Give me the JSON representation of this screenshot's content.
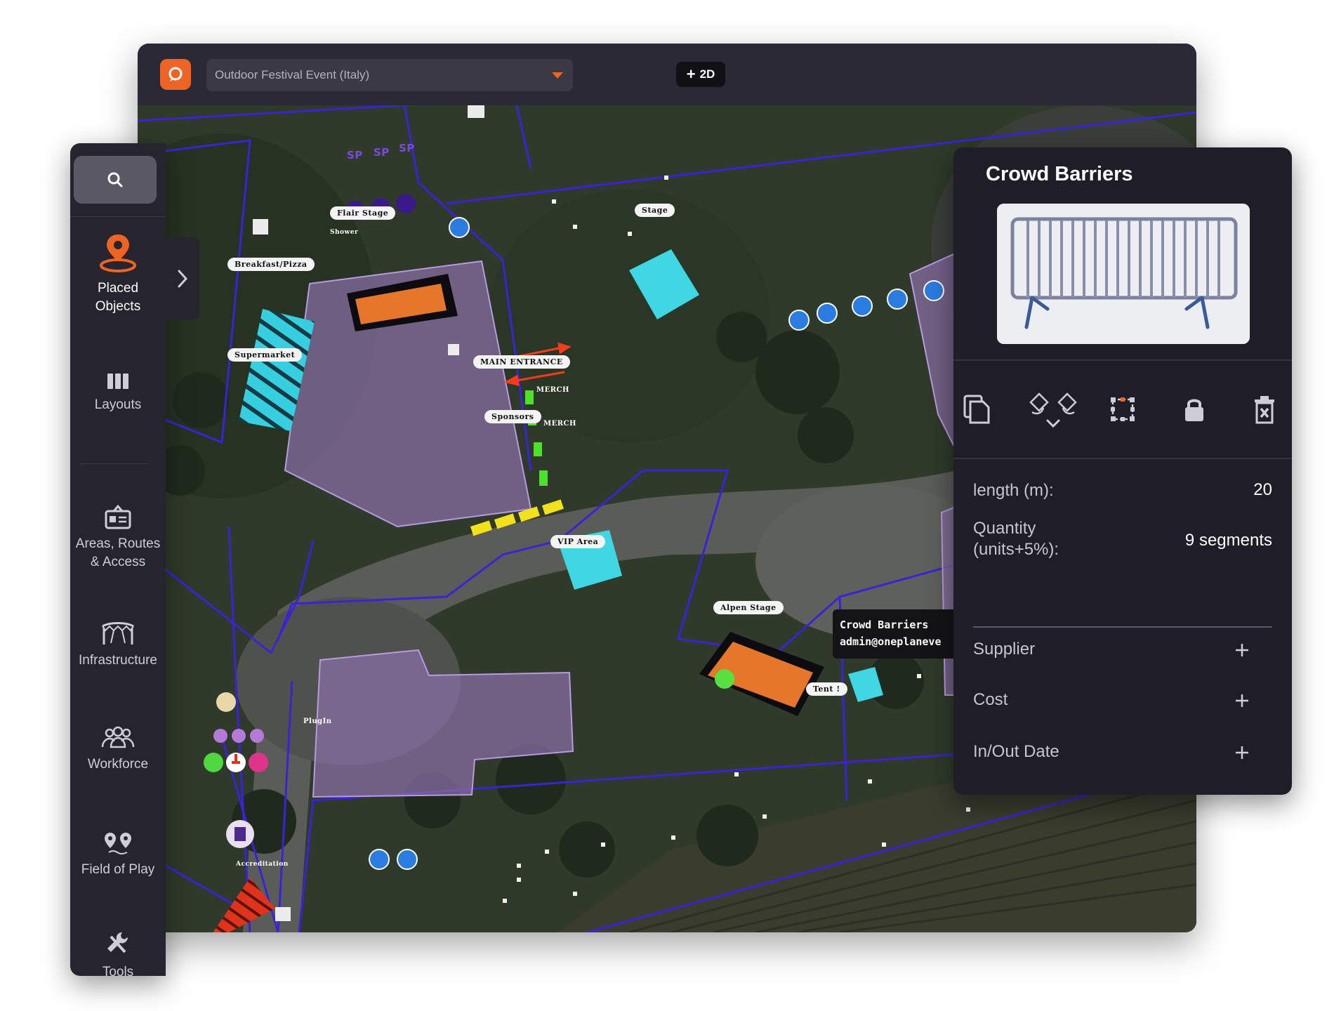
{
  "topbar": {
    "project_name": "Outdoor Festival Event (Italy)",
    "view_mode_label": "2D"
  },
  "sidebar": {
    "items": [
      {
        "label_line1": "Placed",
        "label_line2": "Objects",
        "icon": "map-pin-icon",
        "active": true
      },
      {
        "label_line1": "Layouts",
        "label_line2": "",
        "icon": "layouts-icon"
      },
      {
        "label_line1": "Areas, Routes",
        "label_line2": "& Access",
        "icon": "id-card-icon"
      },
      {
        "label_line1": "Infrastructure",
        "label_line2": "",
        "icon": "tent-icon"
      },
      {
        "label_line1": "Workforce",
        "label_line2": "",
        "icon": "people-icon"
      },
      {
        "label_line1": "Field of Play",
        "label_line2": "",
        "icon": "location-pins-icon"
      },
      {
        "label_line1": "Tools",
        "label_line2": "",
        "icon": "wrench-icon"
      }
    ]
  },
  "map": {
    "labels": {
      "flair_stage": "Flair Stage",
      "shower": "Shower",
      "breakfast": "Breakfast/Pizza",
      "supermarket": "Supermarket",
      "main_entrance": "MAIN ENTRANCE",
      "sponsors": "Sponsors",
      "merch": "MERCH",
      "stage": "Stage",
      "vip_area": "VIP Area",
      "alpen_stage": "Alpen Stage",
      "tent": "Tent !",
      "plugin": "PlugIn",
      "accreditation": "Accreditation",
      "sp": "SP"
    },
    "tooltip": {
      "line1": "Crowd Barriers",
      "line2": "admin@oneplaneve"
    },
    "zoom_level": "18"
  },
  "panel": {
    "title": "Crowd Barriers",
    "properties": {
      "length_label": "length (m):",
      "length_value": "20",
      "quantity_label_line1": "Quantity",
      "quantity_label_line2": "(units+5%):",
      "quantity_value": "9 segments"
    },
    "sections": {
      "supplier": "Supplier",
      "cost": "Cost",
      "inout_date": "In/Out Date"
    }
  },
  "colors": {
    "accent": "#ee6424",
    "zone_fill": "#8a6fa8",
    "boundary": "#3a23d6",
    "cyan_area": "#3fd7e3",
    "panel_bg": "#1f1d27"
  }
}
